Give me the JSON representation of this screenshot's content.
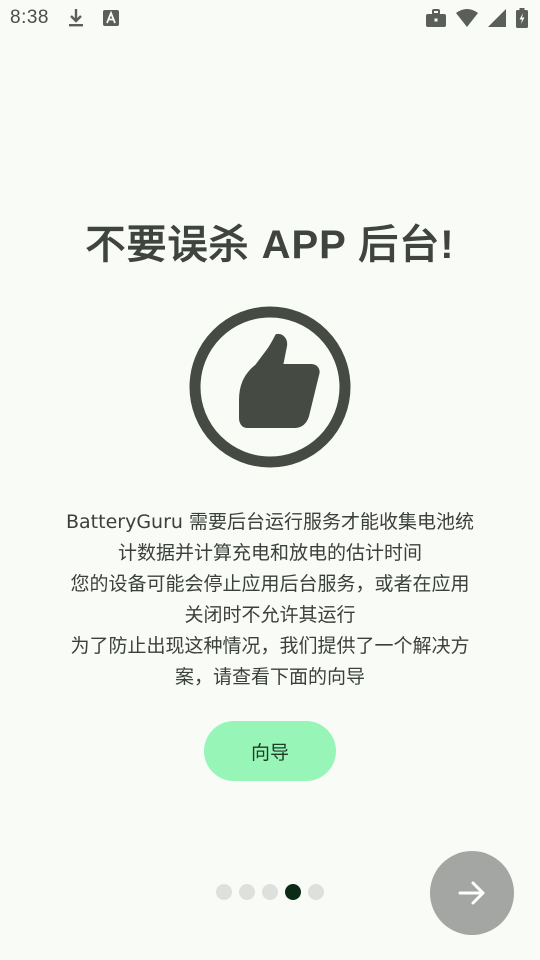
{
  "status_bar": {
    "time": "8:38",
    "icons": [
      "download-icon",
      "text-a-icon",
      "briefcase-icon",
      "wifi-icon",
      "signal-icon",
      "battery-charging-icon"
    ]
  },
  "title": "不要误杀 APP 后台!",
  "hero_icon": "thumbs-up-icon",
  "description_lines": [
    "BatteryGuru 需要后台运行服务才能收集电池统",
    "计数据并计算充电和放电的估计时间",
    "您的设备可能会停止应用后台服务，或者在应用",
    "关闭时不允许其运行",
    "为了防止出现这种情况，我们提供了一个解决方",
    "案，请查看下面的向导"
  ],
  "guide_button_label": "向导",
  "pager": {
    "total_pages": 5,
    "current_page": 4
  },
  "next_button_icon": "arrow-right-icon",
  "colors": {
    "background": "#f9fbf6",
    "title": "#404440",
    "icon": "#454a43",
    "guide_button": "#98f5b8",
    "fab": "#a4a6a4",
    "dot_active": "#0b2b17",
    "dot_inactive": "#dde0dc"
  }
}
